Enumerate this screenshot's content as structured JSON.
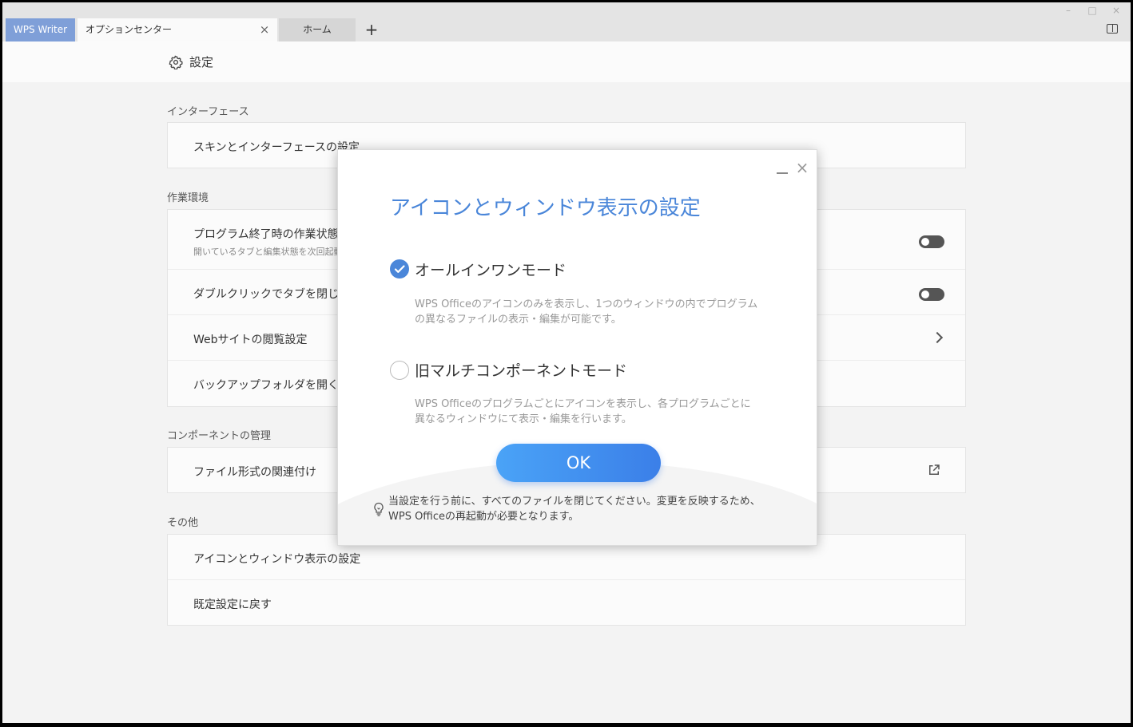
{
  "tabs": {
    "app": "WPS Writer",
    "options": "オプションセンター",
    "home": "ホーム",
    "add": "+",
    "close": "×"
  },
  "window_controls": {
    "minimize": "–",
    "maximize": "□",
    "close": "×"
  },
  "header": {
    "title": "設定"
  },
  "sections": {
    "interface": {
      "label": "インターフェース",
      "items": [
        "スキンとインターフェースの設定"
      ]
    },
    "work": {
      "label": "作業環境",
      "item1": {
        "label": "プログラム終了時の作業状態を",
        "sub": "開いているタブと編集状態を次回起動"
      },
      "item2": "ダブルクリックでタブを閉じる",
      "item3": "Webサイトの閲覧設定",
      "item4": "バックアップフォルダを開く"
    },
    "components": {
      "label": "コンポーネントの管理",
      "item1": "ファイル形式の関連付け"
    },
    "other": {
      "label": "その他",
      "item1": "アイコンとウィンドウ表示の設定",
      "item2": "既定設定に戻す"
    }
  },
  "dialog": {
    "title": "アイコンとウィンドウ表示の設定",
    "option1": {
      "title": "オールインワンモード",
      "desc_line1": "WPS Officeのアイコンのみを表示し、1つのウィンドウの内でプログラム",
      "desc_line2": "の異なるファイルの表示・編集が可能です。",
      "selected": true
    },
    "option2": {
      "title": "旧マルチコンポーネントモード",
      "desc_line1": "WPS Officeのプログラムごとにアイコンを表示し、各プログラムごとに",
      "desc_line2": "異なるウィンドウにて表示・編集を行います。",
      "selected": false
    },
    "ok": "OK",
    "note_line1": "当設定を行う前に、すべてのファイルを閉じてください。変更を反映するため、",
    "note_line2": "WPS Officeの再起動が必要となります。",
    "close": "×"
  },
  "colors": {
    "accent": "#4a86d9",
    "app_tab": "#7f9fd8",
    "button_start": "#4aa3f7",
    "button_end": "#3b7fe8"
  }
}
